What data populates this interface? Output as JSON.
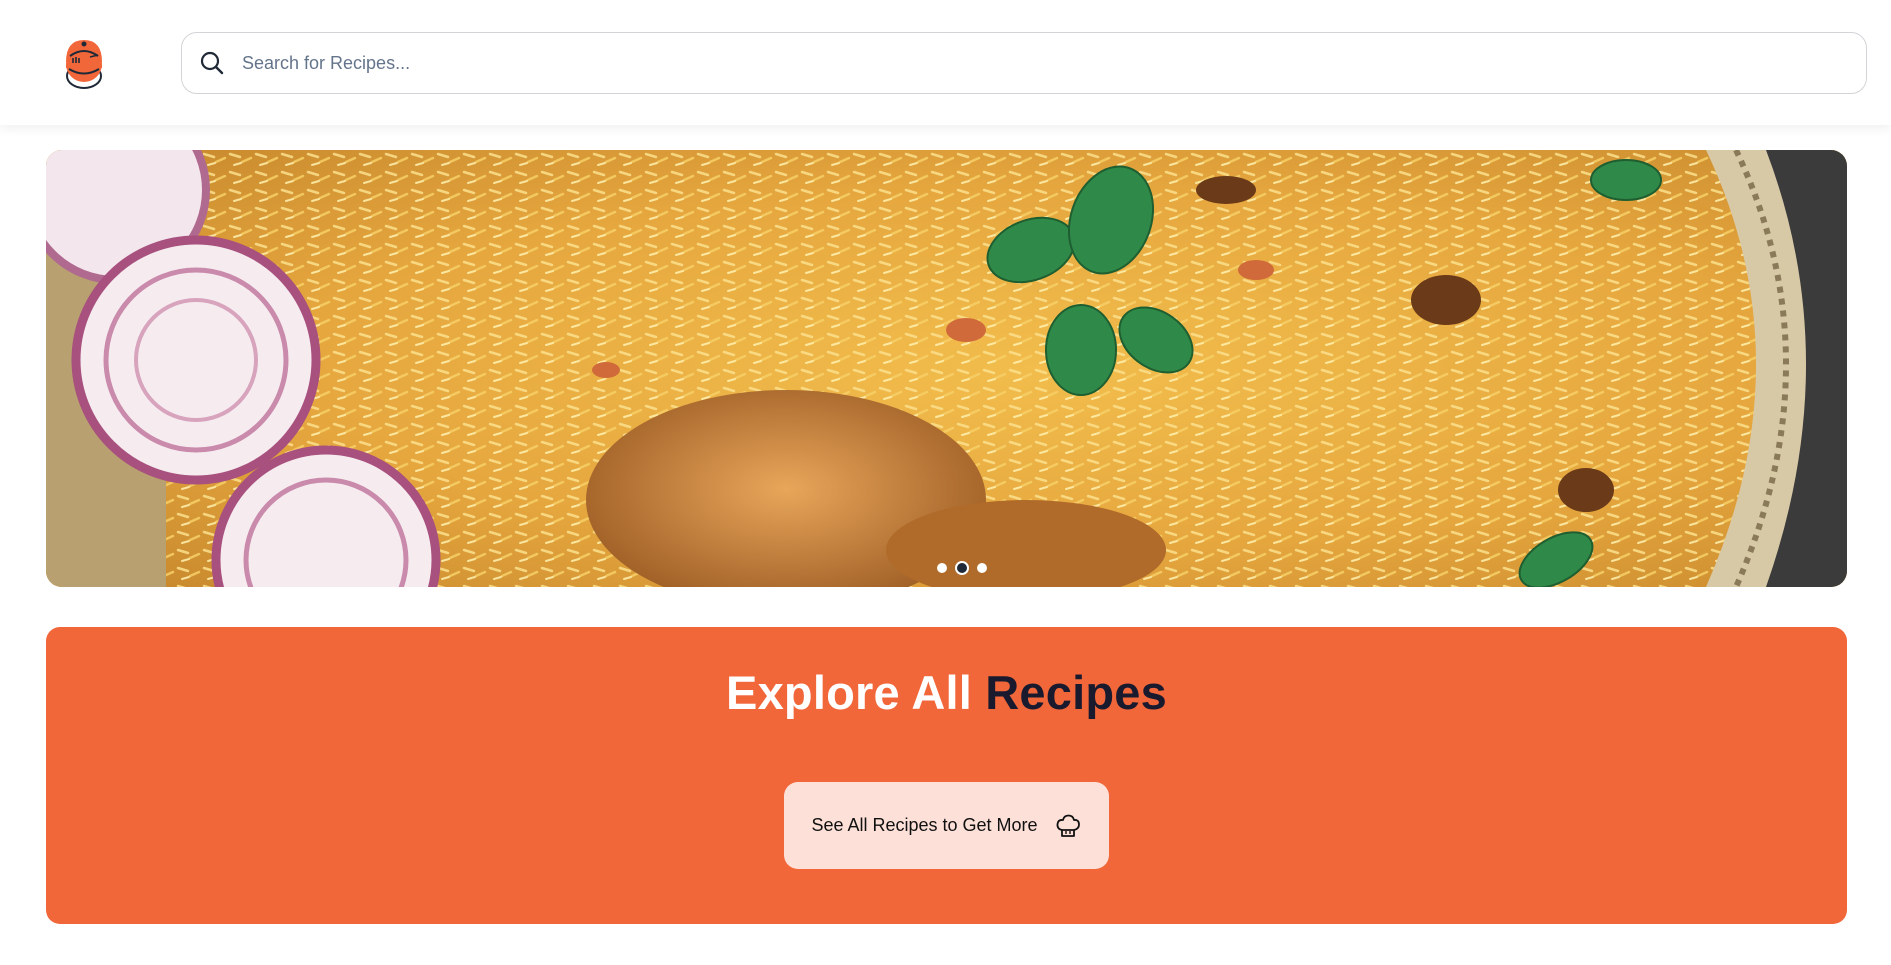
{
  "header": {
    "logo_icon": "chef-pot-logo-icon",
    "search": {
      "icon": "search-icon",
      "placeholder": "Search for Recipes...",
      "value": ""
    }
  },
  "hero": {
    "image": "biryani-plate-banner",
    "carousel": {
      "slides": 3,
      "active_index": 1
    }
  },
  "explore": {
    "title_part1": "Explore All",
    "title_part2": "Recipes",
    "button_label": "See All Recipes to Get More",
    "button_icon": "chef-hat-icon"
  },
  "colors": {
    "accent": "#f2673a",
    "button_bg": "#fde0d8",
    "title_dark": "#1a1a2e"
  }
}
